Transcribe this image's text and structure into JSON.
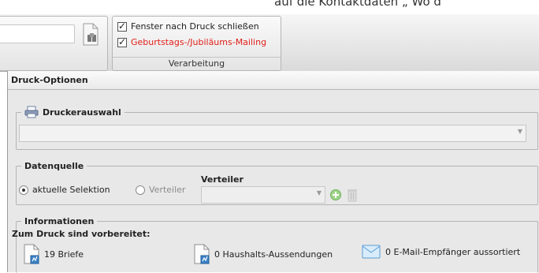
{
  "top_partial_text": "auf die Kontaktdaten „ Wo d",
  "ribbon": {
    "search_value": "",
    "checkboxes": [
      {
        "label": "Fenster nach Druck schließen",
        "checked": true
      },
      {
        "label": "Geburtstags-/Jubiläums-Mailing",
        "checked": true,
        "color": "#e0201a"
      }
    ],
    "group_label": "Verarbeitung"
  },
  "panel": {
    "title": "Druck-Optionen",
    "druckerauswahl": {
      "legend": "Druckerauswahl",
      "selected": ""
    },
    "datenquelle": {
      "legend": "Datenquelle",
      "option_selection": "aktuelle Selektion",
      "option_verteiler": "Verteiler",
      "verteiler_label": "Verteiler",
      "verteiler_selected": ""
    },
    "informationen": {
      "legend": "Informationen",
      "heading": "Zum Druck sind vorbereitet:",
      "items": [
        {
          "icon": "letter-document-icon",
          "text": "19 Briefe"
        },
        {
          "icon": "household-document-icon",
          "text": "0 Haushalts-Aussendungen"
        },
        {
          "icon": "email-envelope-icon",
          "text": "0 E-Mail-Empfänger aussortiert"
        }
      ]
    }
  }
}
